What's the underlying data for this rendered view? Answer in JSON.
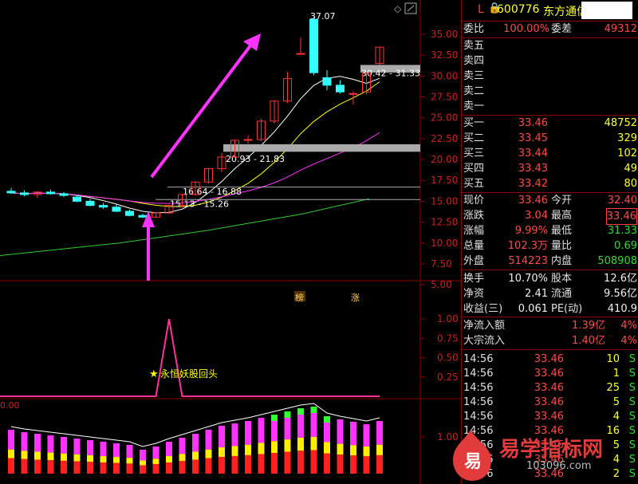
{
  "header": {
    "code_marker": "L",
    "stock_code": "600776",
    "stock_name": "东方通信"
  },
  "main_chart": {
    "price_ticks": [
      "35.00",
      "32.50",
      "30.00",
      "27.50",
      "25.00",
      "22.50",
      "20.00",
      "17.50",
      "15.00",
      "12.50",
      "10.00",
      "7.50",
      "5.00"
    ],
    "annotations": {
      "high_label": "37.07",
      "box1_label": "30.42 - 31.33",
      "box2_label": "20.93 - 21.83",
      "box3_label": "16.64 - 16.88",
      "box4_label": "15.13 - 15.26"
    },
    "markers": {
      "bang": "榜",
      "zhang": "涨"
    }
  },
  "signal_chart": {
    "ticks": [
      "1.00",
      "0.75",
      "0.50",
      "0.25"
    ],
    "caption": "永恒妖股回头"
  },
  "volume_chart": {
    "left_label": "0.00",
    "tick": "1.00"
  },
  "quote": {
    "weibi_label": "委比",
    "weibi_value": "100.00%",
    "weicha_label": "委差",
    "weicha_value": "49312",
    "sell_labels": [
      "卖五",
      "卖四",
      "卖三",
      "卖二",
      "卖一"
    ],
    "buy": [
      {
        "label": "买一",
        "price": "33.46",
        "vol": "48752"
      },
      {
        "label": "买二",
        "price": "33.45",
        "vol": "329"
      },
      {
        "label": "买三",
        "price": "33.44",
        "vol": "102"
      },
      {
        "label": "买四",
        "price": "33.43",
        "vol": "49"
      },
      {
        "label": "买五",
        "price": "33.42",
        "vol": "80"
      }
    ],
    "stats": [
      {
        "l1": "现价",
        "v1": "33.46",
        "l2": "今开",
        "v2": "32.40"
      },
      {
        "l1": "涨跌",
        "v1": "3.04",
        "l2": "最高",
        "v2": "33.46"
      },
      {
        "l1": "涨幅",
        "v1": "9.99%",
        "l2": "最低",
        "v2": "31.33"
      },
      {
        "l1": "总量",
        "v1": "102.3万",
        "l2": "量比",
        "v2": "0.69"
      },
      {
        "l1": "外盘",
        "v1": "514223",
        "l2": "内盘",
        "v2": "508908"
      }
    ],
    "stats2": [
      {
        "l1": "换手",
        "v1": "10.70%",
        "l2": "股本",
        "v2": "12.6亿"
      },
      {
        "l1": "净资",
        "v1": "2.41",
        "l2": "流通",
        "v2": "9.56亿"
      },
      {
        "l1": "收益(三)",
        "v1": "0.061",
        "l2": "PE(动)",
        "v2": "410.9"
      }
    ],
    "flows": [
      {
        "label": "净流入额",
        "value": "1.39亿",
        "pct": "4%"
      },
      {
        "label": "大宗流入",
        "value": "1.40亿",
        "pct": "4%"
      }
    ],
    "trades": [
      {
        "time": "14:56",
        "price": "33.46",
        "vol": "10",
        "side": "S"
      },
      {
        "time": "14:56",
        "price": "33.46",
        "vol": "1",
        "side": "S"
      },
      {
        "time": "14:56",
        "price": "33.46",
        "vol": "25",
        "side": "S"
      },
      {
        "time": "14:56",
        "price": "33.46",
        "vol": "5",
        "side": "S"
      },
      {
        "time": "14:56",
        "price": "33.46",
        "vol": "4",
        "side": "S"
      },
      {
        "time": "14:56",
        "price": "33.46",
        "vol": "16",
        "side": "S"
      },
      {
        "time": "14:56",
        "price": "33.46",
        "vol": "5",
        "side": "S"
      },
      {
        "time": "14:56",
        "price": "33.46",
        "vol": "4",
        "side": "S"
      },
      {
        "time": "14:56",
        "price": "33.46",
        "vol": "2",
        "side": "S"
      }
    ]
  },
  "watermark": {
    "logo_char": "易",
    "site_name": "易学指标网",
    "site_url": "103096.com"
  },
  "colors": {
    "up": "#ff3333",
    "down": "#33ffff",
    "ma_white": "#ffffff",
    "ma_yellow": "#ffff00",
    "ma_magenta": "#ff33ff",
    "ma_green": "#33cc33",
    "grid": "#8b0000",
    "arrow": "#ff33ff"
  },
  "chart_data": {
    "type": "candlestick",
    "candles": [
      {
        "o": 16.2,
        "h": 16.6,
        "l": 15.9,
        "c": 16.0
      },
      {
        "o": 16.0,
        "h": 16.3,
        "l": 15.6,
        "c": 15.8
      },
      {
        "o": 15.8,
        "h": 16.2,
        "l": 15.4,
        "c": 16.1
      },
      {
        "o": 16.1,
        "h": 16.4,
        "l": 15.8,
        "c": 15.9
      },
      {
        "o": 15.9,
        "h": 16.1,
        "l": 15.5,
        "c": 15.7
      },
      {
        "o": 15.5,
        "h": 15.7,
        "l": 14.9,
        "c": 15.0
      },
      {
        "o": 15.0,
        "h": 15.3,
        "l": 14.4,
        "c": 14.5
      },
      {
        "o": 14.5,
        "h": 14.8,
        "l": 14.1,
        "c": 14.3
      },
      {
        "o": 14.3,
        "h": 14.6,
        "l": 13.7,
        "c": 13.8
      },
      {
        "o": 13.8,
        "h": 14.0,
        "l": 13.2,
        "c": 13.3
      },
      {
        "o": 13.3,
        "h": 13.5,
        "l": 13.0,
        "c": 13.1
      },
      {
        "o": 13.1,
        "h": 13.7,
        "l": 13.0,
        "c": 13.6
      },
      {
        "o": 13.6,
        "h": 14.6,
        "l": 13.5,
        "c": 14.5
      },
      {
        "o": 14.5,
        "h": 15.9,
        "l": 14.3,
        "c": 15.8
      },
      {
        "o": 15.8,
        "h": 17.4,
        "l": 15.7,
        "c": 17.3
      },
      {
        "o": 17.3,
        "h": 19.0,
        "l": 17.1,
        "c": 18.9
      },
      {
        "o": 18.9,
        "h": 20.8,
        "l": 18.5,
        "c": 20.3
      },
      {
        "o": 20.3,
        "h": 22.4,
        "l": 20.2,
        "c": 22.3
      },
      {
        "o": 22.3,
        "h": 22.9,
        "l": 21.9,
        "c": 22.4
      },
      {
        "o": 22.4,
        "h": 24.9,
        "l": 22.2,
        "c": 24.6
      },
      {
        "o": 24.6,
        "h": 27.1,
        "l": 24.3,
        "c": 27.0
      },
      {
        "o": 27.0,
        "h": 30.5,
        "l": 26.8,
        "c": 29.7
      },
      {
        "o": 32.7,
        "h": 34.6,
        "l": 32.6,
        "c": 32.7
      },
      {
        "o": 36.8,
        "h": 37.07,
        "l": 30.1,
        "c": 30.4
      },
      {
        "o": 29.8,
        "h": 30.7,
        "l": 28.3,
        "c": 28.9
      },
      {
        "o": 28.9,
        "h": 29.5,
        "l": 27.9,
        "c": 28.1
      },
      {
        "o": 27.9,
        "h": 28.2,
        "l": 26.6,
        "c": 27.9
      },
      {
        "o": 28.1,
        "h": 30.5,
        "l": 27.8,
        "c": 30.3
      },
      {
        "o": 31.5,
        "h": 33.46,
        "l": 31.33,
        "c": 33.46
      }
    ],
    "signal": [
      0,
      0,
      0,
      0,
      0,
      0,
      0,
      0,
      0,
      0,
      0,
      0,
      1,
      0,
      0,
      0,
      0,
      0,
      0,
      0,
      0,
      0,
      0,
      0,
      0,
      0,
      0,
      0,
      0
    ],
    "ylim": [
      2.5,
      37.5
    ]
  }
}
